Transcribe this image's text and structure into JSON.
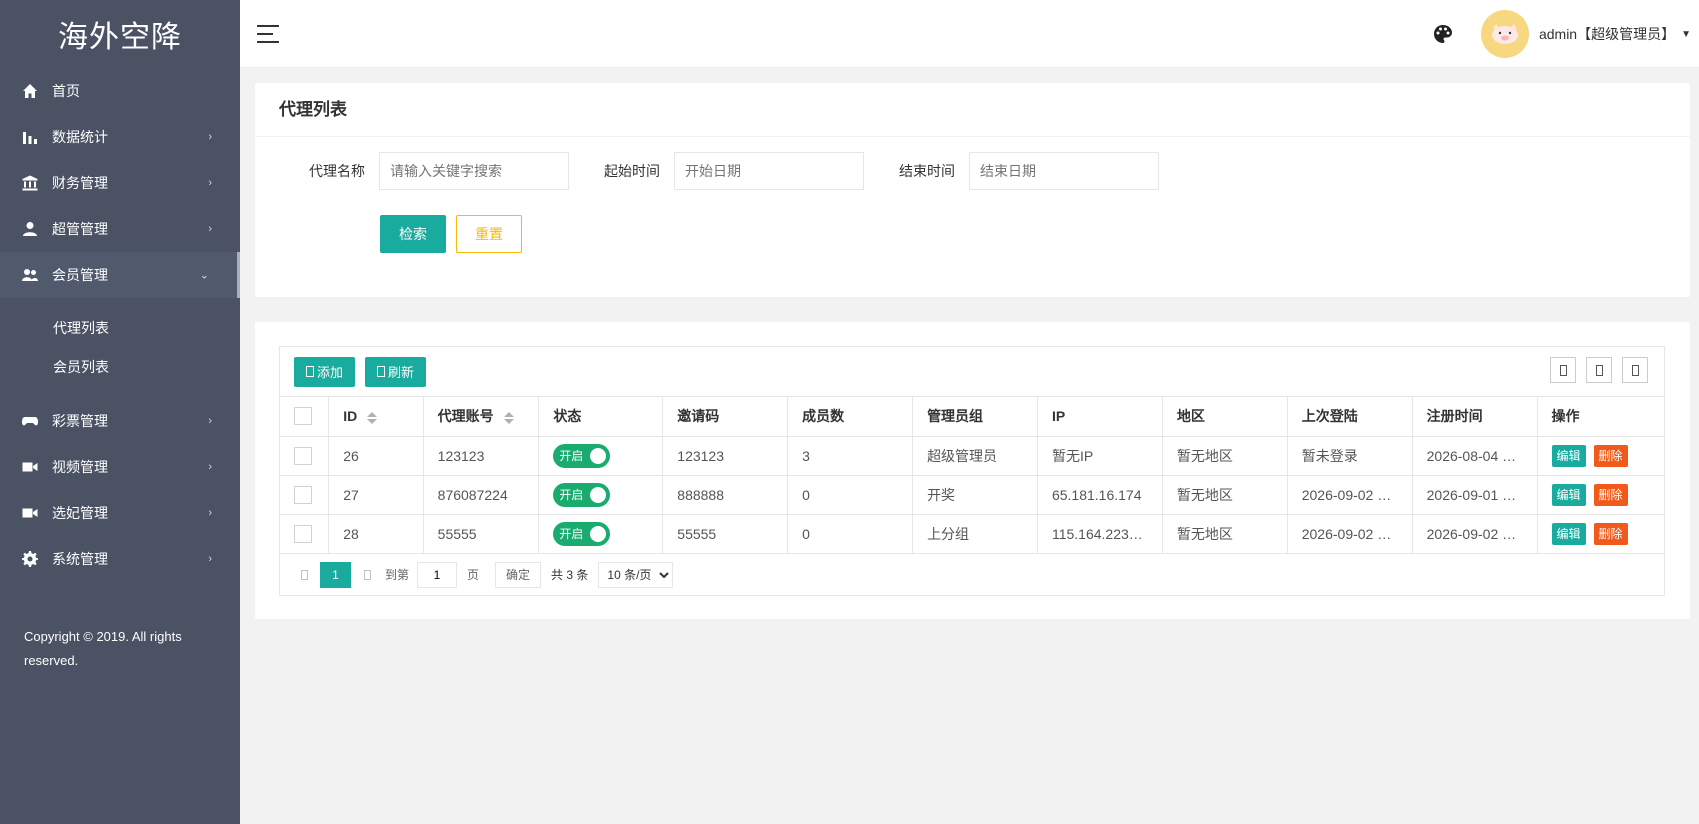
{
  "sidebar": {
    "logo": "海外空降",
    "items": [
      {
        "label": "首页",
        "icon": "home-icon",
        "has_arrow": false
      },
      {
        "label": "数据统计",
        "icon": "bar-chart-icon",
        "has_arrow": true
      },
      {
        "label": "财务管理",
        "icon": "bank-icon",
        "has_arrow": true
      },
      {
        "label": "超管管理",
        "icon": "user-icon",
        "has_arrow": true
      },
      {
        "label": "会员管理",
        "icon": "users-icon",
        "has_arrow": true,
        "expanded": true
      },
      {
        "label": "彩票管理",
        "icon": "gamepad-icon",
        "has_arrow": true
      },
      {
        "label": "视频管理",
        "icon": "video-icon",
        "has_arrow": true
      },
      {
        "label": "选妃管理",
        "icon": "video-icon",
        "has_arrow": true
      },
      {
        "label": "系统管理",
        "icon": "gear-icon",
        "has_arrow": true
      }
    ],
    "submenu": [
      "代理列表",
      "会员列表"
    ],
    "copyright": "Copyright © 2019. All rights reserved."
  },
  "header": {
    "user": "admin【超级管理员】"
  },
  "search_card": {
    "title": "代理列表",
    "fields": [
      {
        "label": "代理名称",
        "placeholder": "请输入关键字搜索"
      },
      {
        "label": "起始时间",
        "placeholder": "开始日期"
      },
      {
        "label": "结束时间",
        "placeholder": "结束日期"
      }
    ],
    "search_label": "检索",
    "reset_label": "重置"
  },
  "table": {
    "add_label": "添加",
    "refresh_label": "刷新",
    "columns": [
      "ID",
      "代理账号",
      "状态",
      "邀请码",
      "成员数",
      "管理员组",
      "IP",
      "地区",
      "上次登陆",
      "注册时间",
      "操作"
    ],
    "rows": [
      {
        "id": "26",
        "account": "123123",
        "status": "开启",
        "invite": "123123",
        "members": "3",
        "group": "超级管理员",
        "ip": "暂无IP",
        "region": "暂无地区",
        "last_login": "暂未登录",
        "register": "2026-08-04 …"
      },
      {
        "id": "27",
        "account": "876087224",
        "status": "开启",
        "invite": "888888",
        "members": "0",
        "group": "开奖",
        "ip": "65.181.16.174",
        "region": "暂无地区",
        "last_login": "2026-09-02 …",
        "register": "2026-09-01 …"
      },
      {
        "id": "28",
        "account": "55555",
        "status": "开启",
        "invite": "55555",
        "members": "0",
        "group": "上分组",
        "ip": "115.164.223…",
        "region": "暂无地区",
        "last_login": "2026-09-02 …",
        "register": "2026-09-02 …"
      }
    ],
    "edit_label": "编辑",
    "delete_label": "删除"
  },
  "pager": {
    "current": "1",
    "goto_label": "到第",
    "goto_value": "1",
    "page_label": "页",
    "confirm_label": "确定",
    "total": "共 3 条",
    "page_size": "10 条/页"
  },
  "colors": {
    "sidebar_bg": "#4a5264",
    "primary": "#1aab9f",
    "warning": "#ffb800",
    "danger": "#f05a1a",
    "switch_on": "#1aab6f"
  }
}
